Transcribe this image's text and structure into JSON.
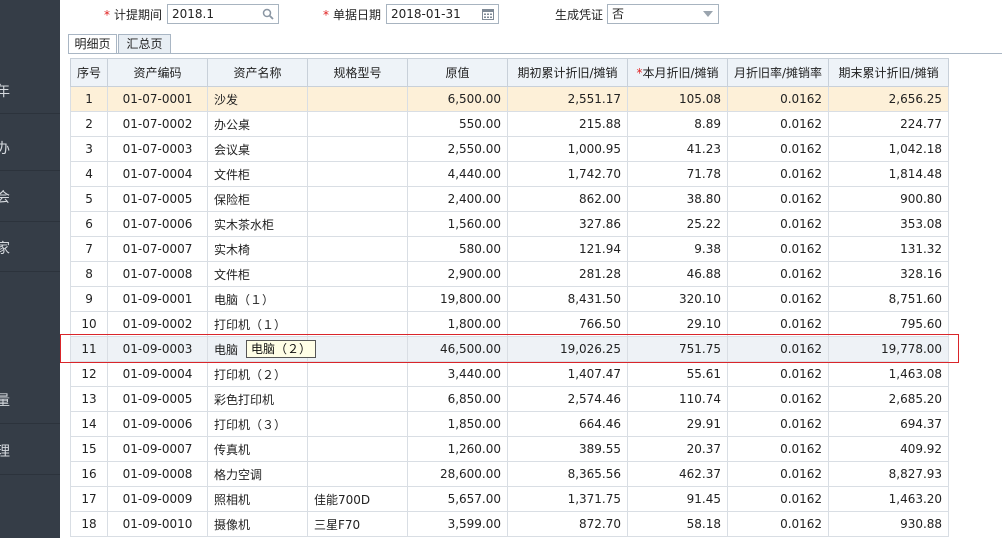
{
  "sidebar": {
    "items": [
      {
        "char": "年"
      },
      {
        "char": "办"
      },
      {
        "char": "会"
      },
      {
        "char": "家"
      },
      {
        "char": "量"
      },
      {
        "char": "理"
      }
    ]
  },
  "filters": {
    "period_label": "计提期间",
    "period_value": "2018.1",
    "date_label": "单据日期",
    "date_value": "2018-01-31",
    "voucher_label": "生成凭证",
    "voucher_value": "否",
    "required_mark": "*"
  },
  "tabs": [
    {
      "label": "明细页",
      "active": true
    },
    {
      "label": "汇总页",
      "active": false
    }
  ],
  "grid": {
    "headers": {
      "seq": "序号",
      "code": "资产编码",
      "name": "资产名称",
      "spec": "规格型号",
      "orig": "原值",
      "begin": "期初累计折旧/摊销",
      "month_req": "*",
      "month": "本月折旧/摊销",
      "rate": "月折旧率/摊销率",
      "end": "期末累计折旧/摊销"
    },
    "rows": [
      {
        "seq": "1",
        "code": "01-07-0001",
        "name": "沙发",
        "spec": "",
        "orig": "6,500.00",
        "begin": "2,551.17",
        "month": "105.08",
        "rate": "0.0162",
        "end": "2,656.25"
      },
      {
        "seq": "2",
        "code": "01-07-0002",
        "name": "办公桌",
        "spec": "",
        "orig": "550.00",
        "begin": "215.88",
        "month": "8.89",
        "rate": "0.0162",
        "end": "224.77"
      },
      {
        "seq": "3",
        "code": "01-07-0003",
        "name": "会议桌",
        "spec": "",
        "orig": "2,550.00",
        "begin": "1,000.95",
        "month": "41.23",
        "rate": "0.0162",
        "end": "1,042.18"
      },
      {
        "seq": "4",
        "code": "01-07-0004",
        "name": "文件柜",
        "spec": "",
        "orig": "4,440.00",
        "begin": "1,742.70",
        "month": "71.78",
        "rate": "0.0162",
        "end": "1,814.48"
      },
      {
        "seq": "5",
        "code": "01-07-0005",
        "name": "保险柜",
        "spec": "",
        "orig": "2,400.00",
        "begin": "862.00",
        "month": "38.80",
        "rate": "0.0162",
        "end": "900.80"
      },
      {
        "seq": "6",
        "code": "01-07-0006",
        "name": "实木茶水柜",
        "spec": "",
        "orig": "1,560.00",
        "begin": "327.86",
        "month": "25.22",
        "rate": "0.0162",
        "end": "353.08"
      },
      {
        "seq": "7",
        "code": "01-07-0007",
        "name": "实木椅",
        "spec": "",
        "orig": "580.00",
        "begin": "121.94",
        "month": "9.38",
        "rate": "0.0162",
        "end": "131.32"
      },
      {
        "seq": "8",
        "code": "01-07-0008",
        "name": "文件柜",
        "spec": "",
        "orig": "2,900.00",
        "begin": "281.28",
        "month": "46.88",
        "rate": "0.0162",
        "end": "328.16"
      },
      {
        "seq": "9",
        "code": "01-09-0001",
        "name": "电脑（１）",
        "spec": "",
        "orig": "19,800.00",
        "begin": "8,431.50",
        "month": "320.10",
        "rate": "0.0162",
        "end": "8,751.60"
      },
      {
        "seq": "10",
        "code": "01-09-0002",
        "name": "打印机（１）",
        "spec": "",
        "orig": "1,800.00",
        "begin": "766.50",
        "month": "29.10",
        "rate": "0.0162",
        "end": "795.60"
      },
      {
        "seq": "11",
        "code": "01-09-0003",
        "name": "电脑（",
        "spec": "",
        "orig": "46,500.00",
        "begin": "19,026.25",
        "month": "751.75",
        "rate": "0.0162",
        "end": "19,778.00"
      },
      {
        "seq": "12",
        "code": "01-09-0004",
        "name": "打印机（２）",
        "spec": "",
        "orig": "3,440.00",
        "begin": "1,407.47",
        "month": "55.61",
        "rate": "0.0162",
        "end": "1,463.08"
      },
      {
        "seq": "13",
        "code": "01-09-0005",
        "name": "彩色打印机",
        "spec": "",
        "orig": "6,850.00",
        "begin": "2,574.46",
        "month": "110.74",
        "rate": "0.0162",
        "end": "2,685.20"
      },
      {
        "seq": "14",
        "code": "01-09-0006",
        "name": "打印机（３）",
        "spec": "",
        "orig": "1,850.00",
        "begin": "664.46",
        "month": "29.91",
        "rate": "0.0162",
        "end": "694.37"
      },
      {
        "seq": "15",
        "code": "01-09-0007",
        "name": "传真机",
        "spec": "",
        "orig": "1,260.00",
        "begin": "389.55",
        "month": "20.37",
        "rate": "0.0162",
        "end": "409.92"
      },
      {
        "seq": "16",
        "code": "01-09-0008",
        "name": "格力空调",
        "spec": "",
        "orig": "28,600.00",
        "begin": "8,365.56",
        "month": "462.37",
        "rate": "0.0162",
        "end": "8,827.93"
      },
      {
        "seq": "17",
        "code": "01-09-0009",
        "name": "照相机",
        "spec": "佳能700D",
        "orig": "5,657.00",
        "begin": "1,371.75",
        "month": "91.45",
        "rate": "0.0162",
        "end": "1,463.20"
      },
      {
        "seq": "18",
        "code": "01-09-0010",
        "name": "摄像机",
        "spec": "三星F70",
        "orig": "3,599.00",
        "begin": "872.70",
        "month": "58.18",
        "rate": "0.0162",
        "end": "930.88"
      }
    ]
  },
  "tooltip": {
    "text": "电脑（２）"
  },
  "colors": {
    "sidebar": "#353d47",
    "required": "#e02020",
    "highlight_border": "#d9252a",
    "first_row": "#fdf0d8"
  }
}
